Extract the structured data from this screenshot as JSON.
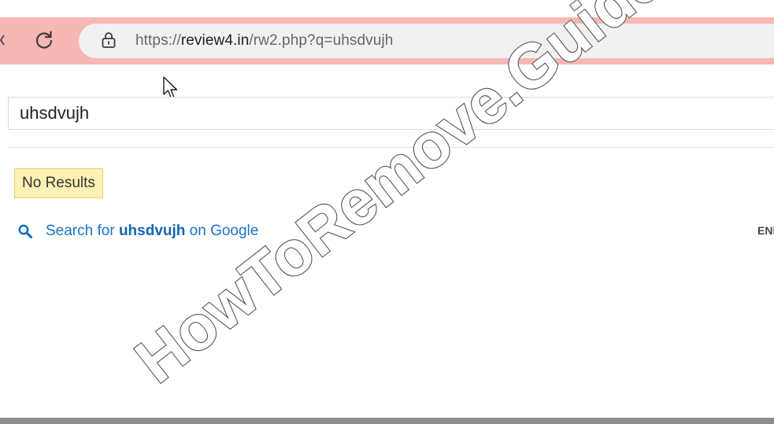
{
  "browser": {
    "url_scheme": "https://",
    "url_host": "review4.in",
    "url_path": "/rw2.php?q=uhsdvujh",
    "icons": [
      "reload-icon",
      "lock-icon",
      "cursor-icon"
    ],
    "toolbar_color": "#f7b7b5"
  },
  "search": {
    "query": "uhsdvujh"
  },
  "results": {
    "no_results_label": "No Results",
    "google_prefix": "Search for ",
    "google_query": "uhsdvujh",
    "google_suffix": " on Google",
    "lang_code": "ENI"
  },
  "watermark": {
    "text": "HowToRemove.Guide"
  },
  "colors": {
    "link": "#1a73c8",
    "badge_bg": "#fdf2b3",
    "badge_border": "#e9cf6a"
  }
}
